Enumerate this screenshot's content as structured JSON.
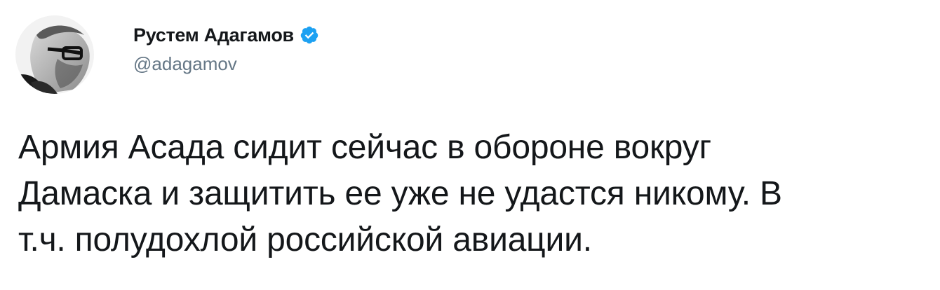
{
  "author": {
    "display_name": "Рустем Адагамов",
    "handle": "@adagamov",
    "verified": true,
    "verified_color": "#1da1f2"
  },
  "tweet": {
    "text": "Армия Асада сидит сейчас в обороне вокруг\nДамаска и защитить ее уже не удастся никому. В\nт.ч. полудохлой российской авиации."
  },
  "icons": {
    "avatar": "profile-photo",
    "verified": "verified-badge-icon"
  }
}
